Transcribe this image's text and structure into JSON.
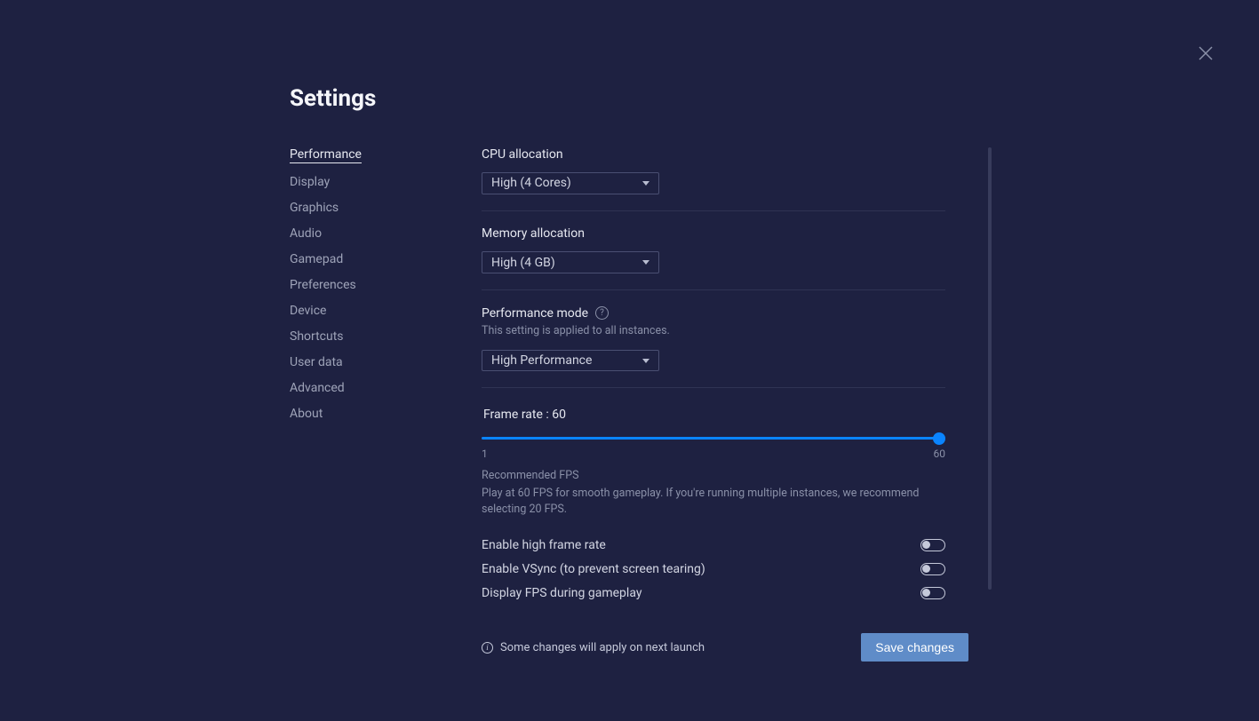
{
  "title": "Settings",
  "close_icon": "✕",
  "sidebar": {
    "items": [
      {
        "label": "Performance"
      },
      {
        "label": "Display"
      },
      {
        "label": "Graphics"
      },
      {
        "label": "Audio"
      },
      {
        "label": "Gamepad"
      },
      {
        "label": "Preferences"
      },
      {
        "label": "Device"
      },
      {
        "label": "Shortcuts"
      },
      {
        "label": "User data"
      },
      {
        "label": "Advanced"
      },
      {
        "label": "About"
      }
    ]
  },
  "cpu": {
    "label": "CPU allocation",
    "value": "High (4 Cores)"
  },
  "memory": {
    "label": "Memory allocation",
    "value": "High (4 GB)"
  },
  "perfmode": {
    "label": "Performance mode",
    "help": "?",
    "sub": "This setting is applied to all instances.",
    "value": "High Performance"
  },
  "framerate": {
    "label": "Frame rate : 60",
    "min": "1",
    "max": "60",
    "rec_title": "Recommended FPS",
    "rec_body": "Play at 60 FPS for smooth gameplay. If you're running multiple instances, we recommend selecting 20 FPS."
  },
  "toggles": {
    "highfps": "Enable high frame rate",
    "vsync": "Enable VSync (to prevent screen tearing)",
    "displayfps": "Display FPS during gameplay"
  },
  "footer": {
    "info_glyph": "i",
    "info": "Some changes will apply on next launch",
    "save": "Save changes"
  }
}
